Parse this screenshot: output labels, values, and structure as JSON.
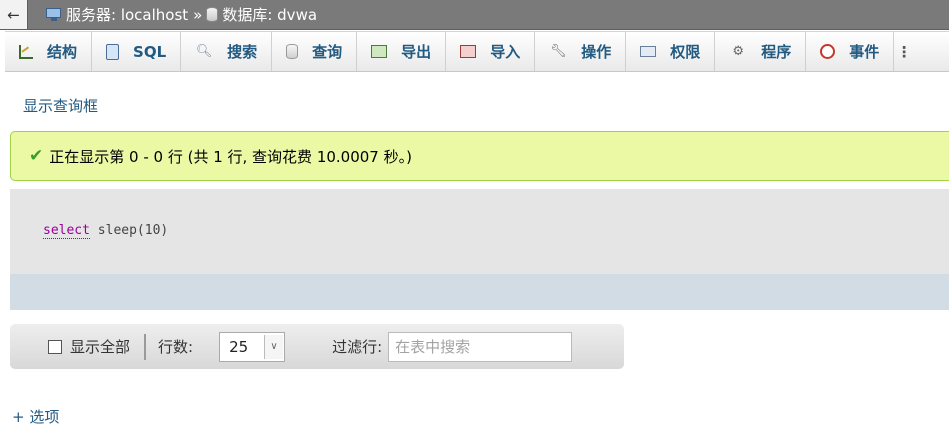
{
  "breadcrumb": {
    "back": "←",
    "server_label": "服务器: localhost",
    "separator": "»",
    "database_label": "数据库: dvwa"
  },
  "tabs": [
    {
      "label": "结构",
      "icon": "structure-icon"
    },
    {
      "label": "SQL",
      "icon": "sql-icon"
    },
    {
      "label": "搜索",
      "icon": "search-icon"
    },
    {
      "label": "查询",
      "icon": "query-icon"
    },
    {
      "label": "导出",
      "icon": "export-icon"
    },
    {
      "label": "导入",
      "icon": "import-icon"
    },
    {
      "label": "操作",
      "icon": "wrench-icon"
    },
    {
      "label": "权限",
      "icon": "privileges-icon"
    },
    {
      "label": "程序",
      "icon": "routines-icon"
    },
    {
      "label": "事件",
      "icon": "events-icon"
    }
  ],
  "tab_more": "⋮",
  "show_query_box": "显示查询框",
  "success_message": "正在显示第 0 - 0 行 (共 1 行, 查询花费 10.0007 秒。)",
  "sql": {
    "keyword": "select",
    "rest": " sleep(10)"
  },
  "nav": {
    "show_all_label": "显示全部",
    "rows_label": "行数:",
    "rows_value": "25",
    "filter_label": "过滤行:",
    "filter_placeholder": "在表中搜索"
  },
  "options_link": "+ 选项",
  "colors": {
    "topbar": "#7a7a7a",
    "link": "#235a81",
    "success_bg": "#ebf8a4",
    "success_border": "#a2d246",
    "sql_bg": "#e5e5e5",
    "sql_footer": "#d2dce4",
    "keyword": "#990099"
  }
}
